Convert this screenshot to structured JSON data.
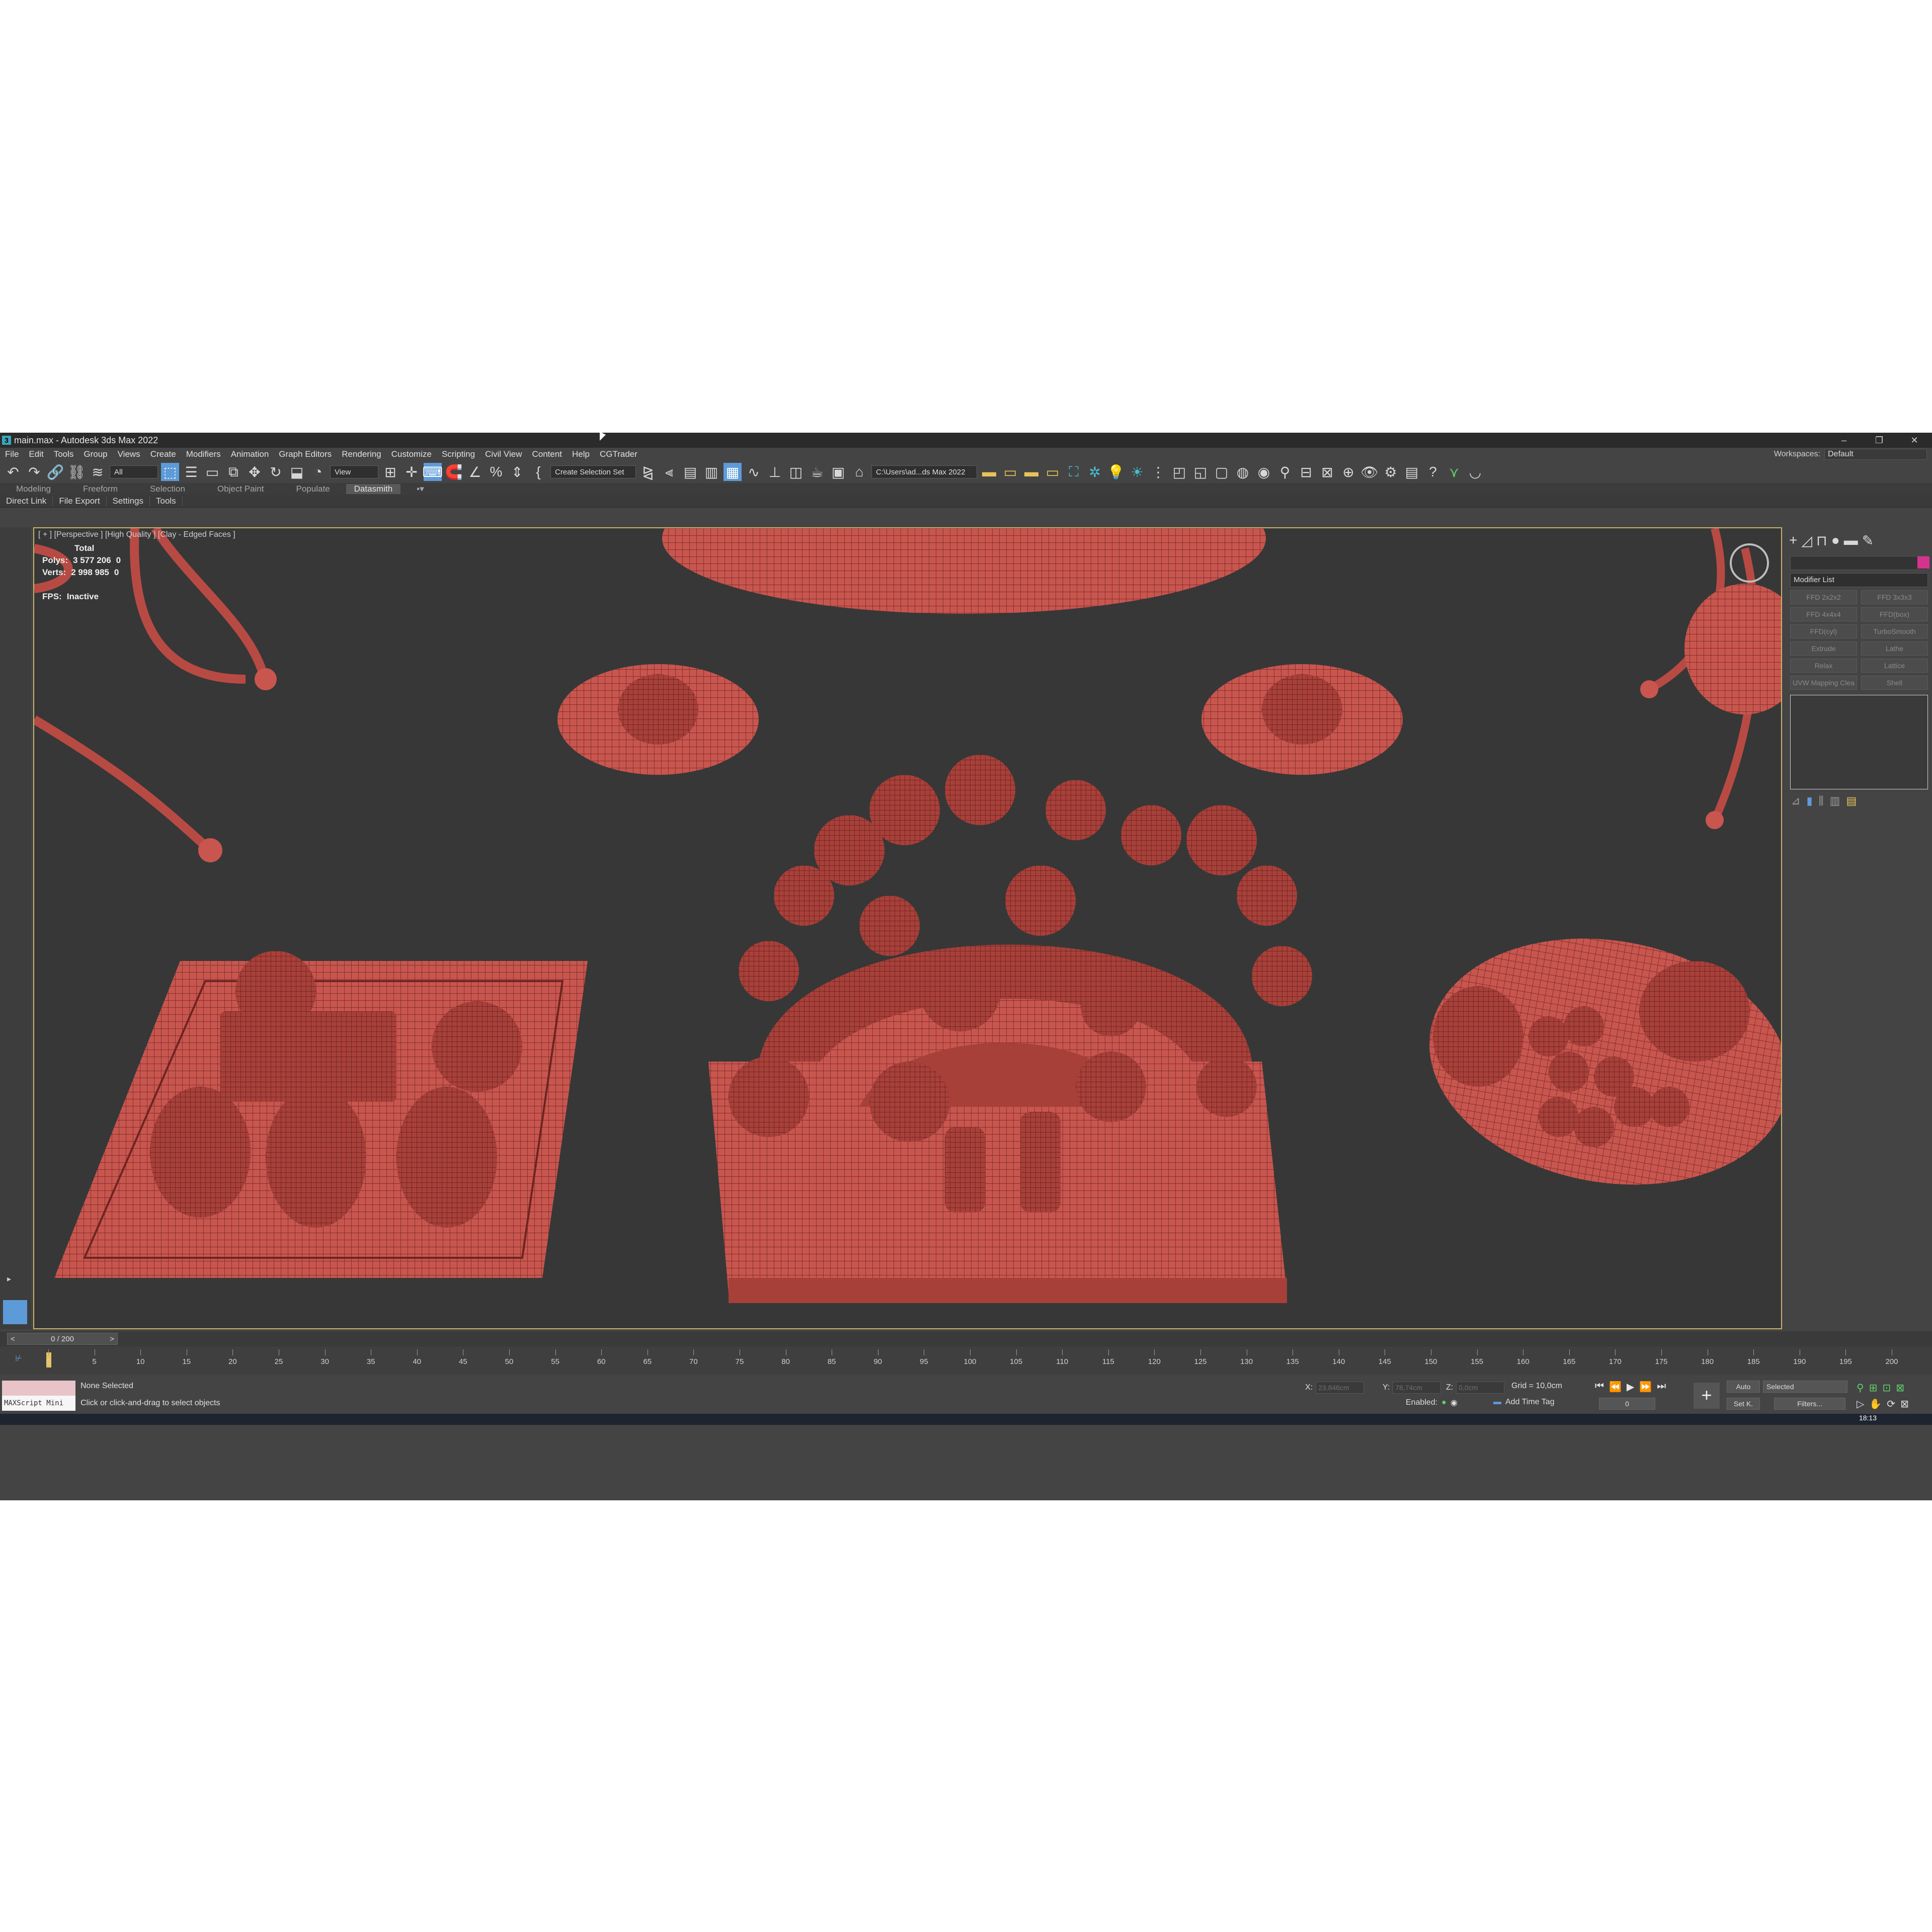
{
  "window": {
    "title": "main.max - Autodesk 3ds Max 2022",
    "app_icon": "3",
    "controls": [
      "–",
      "❐",
      "✕"
    ]
  },
  "menu": {
    "items": [
      "File",
      "Edit",
      "Tools",
      "Group",
      "Views",
      "Create",
      "Modifiers",
      "Animation",
      "Graph Editors",
      "Rendering",
      "Customize",
      "Scripting",
      "Civil View",
      "Content",
      "Help",
      "CGTrader"
    ],
    "workspaces_label": "Workspaces:",
    "workspaces_value": "Default"
  },
  "toolbar": {
    "filter_dropdown": "All",
    "view_dropdown": "View",
    "selection_set_dropdown": "Create Selection Set",
    "path_dropdown": "C:\\Users\\ad...ds Max 2022"
  },
  "ribbon": {
    "tabs": [
      "Modeling",
      "Freeform",
      "Selection",
      "Object Paint",
      "Populate",
      "Datasmith"
    ],
    "active_tab": "Datasmith"
  },
  "subbar": {
    "items": [
      "Direct Link",
      "File Export",
      "Settings",
      "Tools"
    ]
  },
  "viewport": {
    "label": "[ + ] [Perspective ] [High Quality ] [Clay - Edged Faces ]",
    "stats": {
      "total_label": "Total",
      "polys_label": "Polys:",
      "polys_value": "3 577 206",
      "polys_sel": "0",
      "verts_label": "Verts:",
      "verts_value": "2 998 985",
      "verts_sel": "0",
      "fps_label": "FPS:",
      "fps_value": "Inactive"
    }
  },
  "command_panel": {
    "modifier_list": "Modifier List",
    "modifiers": [
      "FFD 2x2x2",
      "FFD 3x3x3",
      "FFD 4x4x4",
      "FFD(box)",
      "FFD(cyl)",
      "TurboSmooth",
      "Extrude",
      "Lathe",
      "Relax",
      "Lattice",
      "UVW Mapping Clea",
      "Shell"
    ],
    "swatch_color": "#d6338f"
  },
  "timeline": {
    "frame_display": "0 / 200",
    "ticks": [
      "0",
      "5",
      "10",
      "15",
      "20",
      "25",
      "30",
      "35",
      "40",
      "45",
      "50",
      "55",
      "60",
      "65",
      "70",
      "75",
      "80",
      "85",
      "90",
      "95",
      "100",
      "105",
      "110",
      "115",
      "120",
      "125",
      "130",
      "135",
      "140",
      "145",
      "150",
      "155",
      "160",
      "165",
      "170",
      "175",
      "180",
      "185",
      "190",
      "195",
      "200"
    ]
  },
  "status": {
    "maxscript_label": "MAXScript Mini",
    "selection": "None Selected",
    "hint": "Click or click-and-drag to select objects",
    "x_label": "X:",
    "x_value": "23,846cm",
    "y_label": "Y:",
    "y_value": "78,74cm",
    "z_label": "Z:",
    "z_value": "0,0cm",
    "grid": "Grid = 10,0cm",
    "enabled_label": "Enabled:",
    "add_time_tag": "Add Time Tag",
    "auto_label": "Auto",
    "selected_label": "Selected",
    "setk_label": "Set K.",
    "filters_label": "Filters...",
    "frame_field": "0"
  },
  "taskbar": {
    "clock": "18:13"
  }
}
